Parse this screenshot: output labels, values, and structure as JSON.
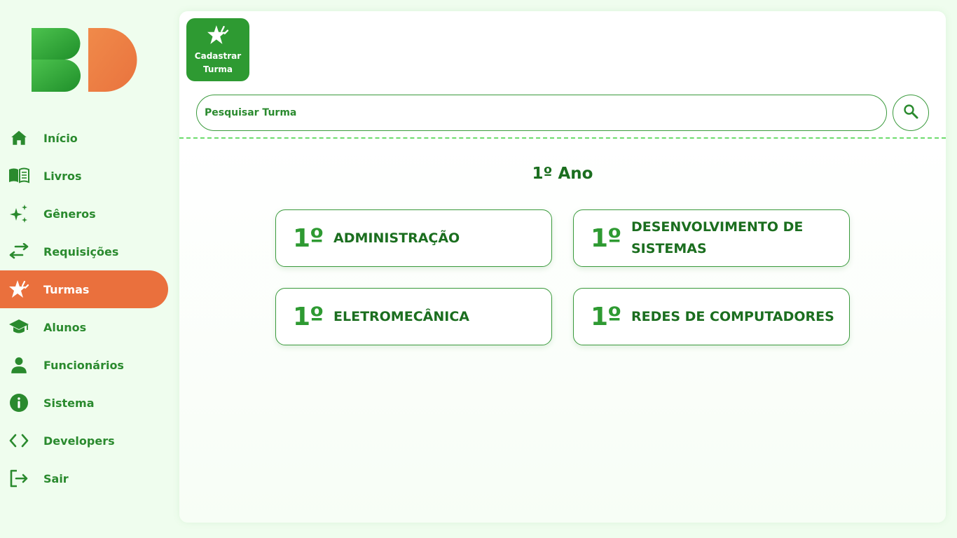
{
  "sidebar": {
    "logo": {
      "letters": "BD",
      "colors": {
        "green": "#2e9a32",
        "orange": "#ea703d"
      }
    },
    "items": [
      {
        "label": "Início",
        "icon": "home-icon",
        "active": false
      },
      {
        "label": "Livros",
        "icon": "book-icon",
        "active": false
      },
      {
        "label": "Gêneros",
        "icon": "sparkles-icon",
        "active": false
      },
      {
        "label": "Requisições",
        "icon": "swap-arrows-icon",
        "active": false
      },
      {
        "label": "Turmas",
        "icon": "star-icon",
        "active": true
      },
      {
        "label": "Alunos",
        "icon": "graduation-cap-icon",
        "active": false
      },
      {
        "label": "Funcionários",
        "icon": "person-icon",
        "active": false
      },
      {
        "label": "Sistema",
        "icon": "info-icon",
        "active": false
      },
      {
        "label": "Developers",
        "icon": "code-icon",
        "active": false
      },
      {
        "label": "Sair",
        "icon": "logout-icon",
        "active": false
      }
    ]
  },
  "main": {
    "register_button": {
      "label_line1": "Cadastrar",
      "label_line2": "Turma",
      "icon": "star-icon"
    },
    "search": {
      "placeholder": "Pesquisar Turma",
      "value": "",
      "icon": "search-icon"
    },
    "year_title": "1º Ano",
    "classes": [
      {
        "year": "1º",
        "name": "ADMINISTRAÇÃO"
      },
      {
        "year": "1º",
        "name": "DESENVOLVIMENTO DE SISTEMAS"
      },
      {
        "year": "1º",
        "name": "ELETROMECÂNICA"
      },
      {
        "year": "1º",
        "name": "REDES DE COMPUTADORES"
      }
    ]
  },
  "colors": {
    "accent_green": "#2e9a32",
    "dark_green": "#1b6e1f",
    "active_orange": "#ea703d",
    "background": "#effdee"
  }
}
